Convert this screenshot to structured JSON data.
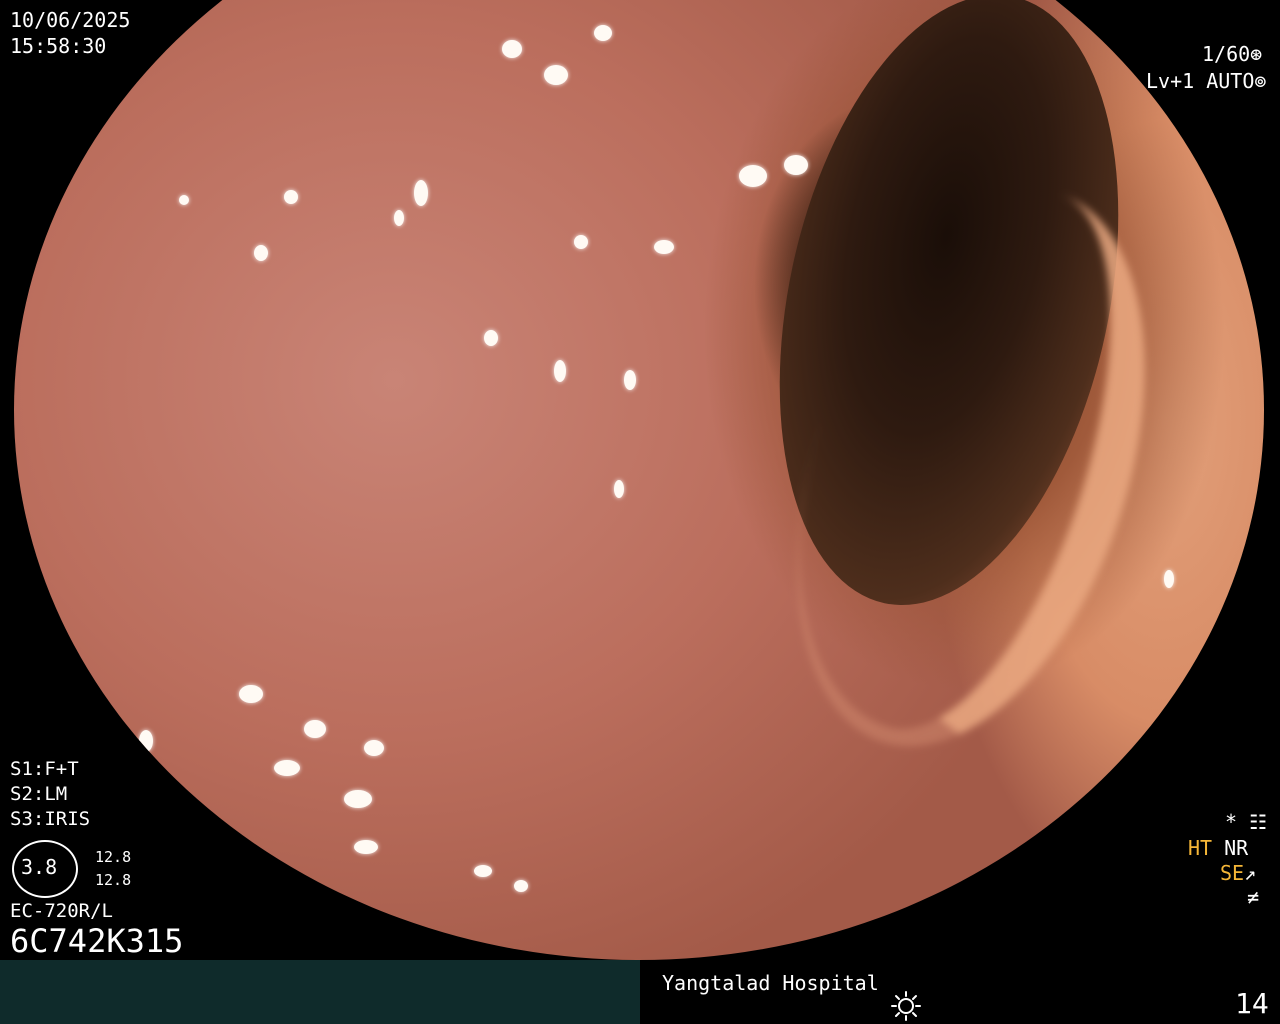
{
  "overlay": {
    "date": "10/06/2025",
    "time": "15:58:30",
    "shutter": "1/60",
    "shutter_icon": "aperture-icon",
    "level": "Lv+1",
    "mode": "AUTO",
    "mode_icon": "iris-icon",
    "s1": "S1:F+T",
    "s2": "S2:LM",
    "s3": "S3:IRIS",
    "magnification": "3.8",
    "mag_value_1": "12.8",
    "mag_value_2": "12.8",
    "scope_model": "EC-720R/L",
    "serial": "6C742K315",
    "asterisk": "*",
    "ht": "HT",
    "nr": "NR",
    "se": "SE",
    "hospital": "Yangtalad Hospital",
    "brightness_icon": "sun-icon",
    "frame_number": "14"
  },
  "colors": {
    "accent_yellow": "#f5b637",
    "footer_bg": "#0f2b2b",
    "background": "#000000"
  }
}
